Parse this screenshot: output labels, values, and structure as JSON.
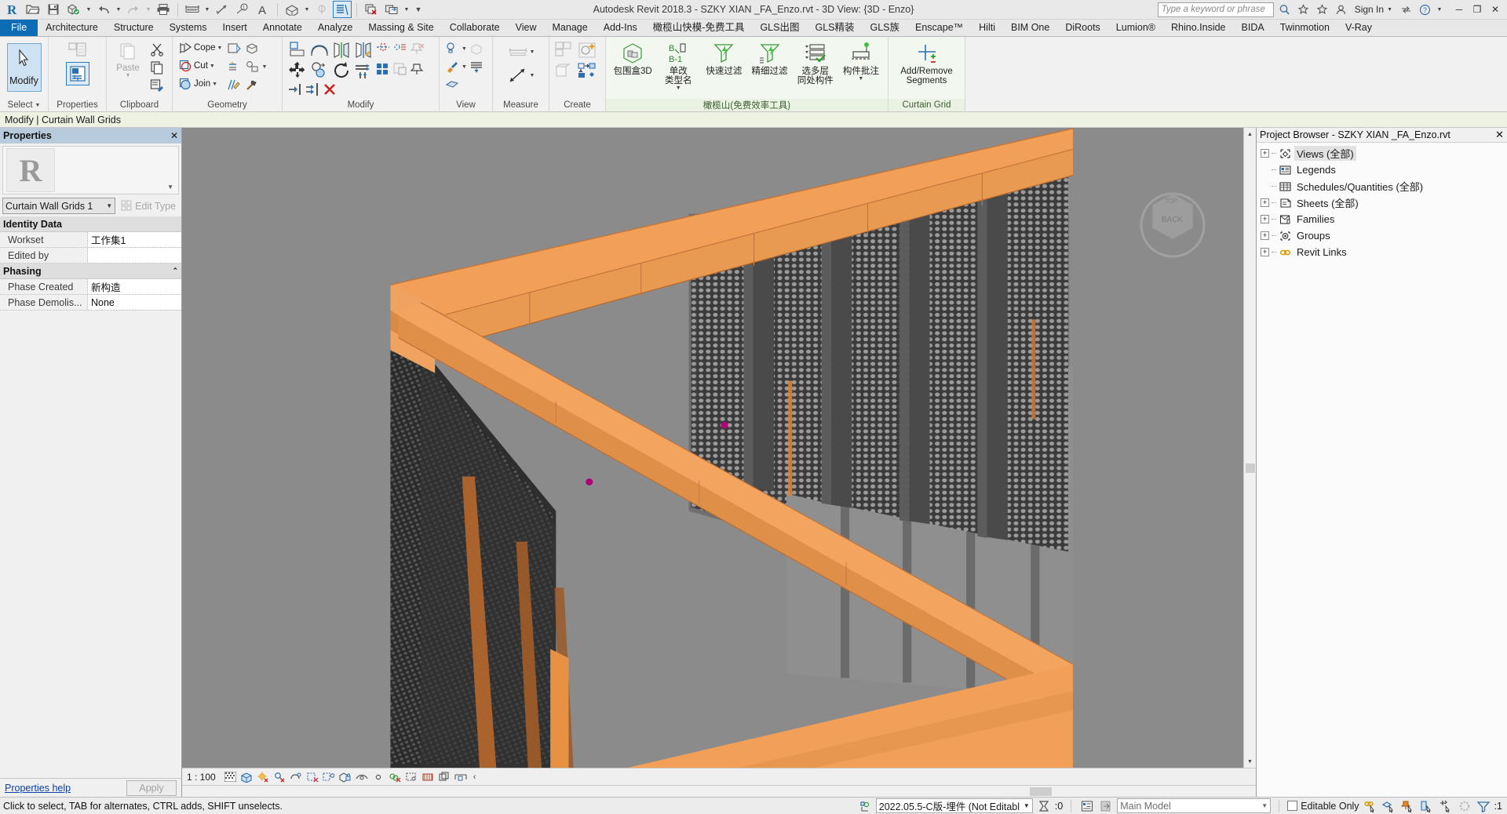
{
  "app": {
    "title": "Autodesk Revit 2018.3 -     SZKY XIAN _FA_Enzo.rvt - 3D View: {3D - Enzo}",
    "signin_label": "Sign In"
  },
  "search": {
    "placeholder": "Type a keyword or phrase",
    "value": ""
  },
  "window_buttons": {
    "minimize": "─",
    "restore": "❐",
    "close": "✕"
  },
  "quick_access": [
    {
      "name": "revit-logo-icon",
      "glyph": "R"
    },
    {
      "name": "open-icon",
      "glyph": "open"
    },
    {
      "name": "save-icon",
      "glyph": "save"
    },
    {
      "name": "sync-with-central-icon",
      "glyph": "sync"
    },
    {
      "name": "undo-icon",
      "glyph": "undo"
    },
    {
      "name": "redo-icon",
      "glyph": "redo"
    },
    {
      "name": "print-icon",
      "glyph": "print"
    },
    {
      "name": "measure-icon",
      "glyph": "measure"
    },
    {
      "name": "aligned-dimension-icon",
      "glyph": "aligned-dim"
    },
    {
      "name": "tag-icon",
      "glyph": "tag"
    },
    {
      "name": "text-icon",
      "glyph": "A"
    },
    {
      "name": "default-3d-view-icon",
      "glyph": "house3d"
    },
    {
      "name": "section-icon",
      "glyph": "section"
    },
    {
      "name": "thin-lines-icon",
      "glyph": "thinlines"
    },
    {
      "name": "close-hidden-windows-icon",
      "glyph": "closehidden"
    },
    {
      "name": "switch-windows-icon",
      "glyph": "switchwin"
    },
    {
      "name": "customize-qat-icon",
      "glyph": "chevron"
    }
  ],
  "tabs": [
    {
      "label": "File",
      "kind": "file"
    },
    {
      "label": "Architecture"
    },
    {
      "label": "Structure"
    },
    {
      "label": "Systems"
    },
    {
      "label": "Insert"
    },
    {
      "label": "Annotate"
    },
    {
      "label": "Analyze"
    },
    {
      "label": "Massing & Site"
    },
    {
      "label": "Collaborate"
    },
    {
      "label": "View"
    },
    {
      "label": "Manage"
    },
    {
      "label": "Add-Ins"
    },
    {
      "label": "橄榄山快模-免费工具"
    },
    {
      "label": "GLS出图"
    },
    {
      "label": "GLS精装"
    },
    {
      "label": "GLS族"
    },
    {
      "label": "Enscape™"
    },
    {
      "label": "Hilti"
    },
    {
      "label": "BIM One"
    },
    {
      "label": "DiRoots"
    },
    {
      "label": "Lumion®"
    },
    {
      "label": "Rhino.Inside"
    },
    {
      "label": "BIDA"
    },
    {
      "label": "Twinmotion"
    },
    {
      "label": "V-Ray"
    }
  ],
  "ribbon": {
    "panels": [
      {
        "name": "select",
        "title": "Select",
        "title_caret": true,
        "buttons": [
          {
            "label": "Modify",
            "name": "modify-button"
          }
        ]
      },
      {
        "name": "properties",
        "title": "Properties",
        "buttons": [
          {
            "label": "",
            "name": "properties-button"
          }
        ]
      },
      {
        "name": "clipboard",
        "title": "Clipboard",
        "buttons": [
          {
            "label": "Paste",
            "name": "paste-button"
          }
        ]
      },
      {
        "name": "geometry",
        "title": "Geometry",
        "buttons": [
          {
            "label": "Cope",
            "name": "cope-button"
          },
          {
            "label": "Cut",
            "name": "cut-button"
          },
          {
            "label": "Join",
            "name": "join-button"
          }
        ]
      },
      {
        "name": "modify",
        "title": "Modify",
        "buttons": []
      },
      {
        "name": "view",
        "title": "View",
        "buttons": []
      },
      {
        "name": "measure",
        "title": "Measure",
        "buttons": []
      },
      {
        "name": "create",
        "title": "Create",
        "buttons": []
      },
      {
        "name": "ganlanshan",
        "title": "橄榄山(免费效率工具)",
        "green": true,
        "buttons": [
          {
            "label": "包围盒3D",
            "name": "bounding-box-3d-button"
          },
          {
            "label": "单改\n类型名",
            "name": "rename-type-button"
          },
          {
            "label": "快速过滤",
            "name": "quick-filter-button"
          },
          {
            "label": "精细过滤",
            "name": "fine-filter-button"
          },
          {
            "label": "选多层\n同处构件",
            "name": "select-overlapping-button"
          },
          {
            "label": "构件批注",
            "name": "batch-annotate-button"
          }
        ]
      },
      {
        "name": "curtain-grid",
        "title": "Curtain Grid",
        "green": true,
        "buttons": [
          {
            "label": "Add/Remove\nSegments",
            "name": "add-remove-segments-button"
          }
        ]
      }
    ]
  },
  "options_bar": {
    "label": "Modify | Curtain Wall Grids"
  },
  "properties": {
    "header": "Properties",
    "close_glyph": "✕",
    "type_selector": "Curtain Wall Grids 1",
    "edit_type_label": "Edit Type",
    "groups": [
      {
        "name": "Identity Data",
        "rows": [
          {
            "name": "Workset",
            "value": "工作集1"
          },
          {
            "name": "Edited by",
            "value": ""
          }
        ]
      },
      {
        "name": "Phasing",
        "collapse_glyph": "⌃",
        "rows": [
          {
            "name": "Phase Created",
            "value": "新构造"
          },
          {
            "name": "Phase Demolis...",
            "value": "None"
          }
        ]
      }
    ],
    "help_link": "Properties help",
    "apply_label": "Apply"
  },
  "view_controls": {
    "scale": "1 : 100",
    "icons": [
      "detail-level-icon",
      "visual-style-icon",
      "sun-path-icon",
      "shadows-icon",
      "rendering-dialog-icon",
      "crop-view-icon",
      "show-crop-region-icon",
      "lock-3d-view-icon",
      "temporary-hide-isolate-icon",
      "reveal-hidden-elements-icon",
      "temporary-view-properties-icon",
      "analytical-model-icon",
      "constraints-icon",
      "worksharing-display-icon",
      "expand-bar-icon"
    ],
    "expand_glyph": "‹"
  },
  "browser": {
    "title": "Project Browser - SZKY XIAN _FA_Enzo.rvt",
    "close_glyph": "✕",
    "nodes": [
      {
        "label": "Views (全部)",
        "icon": "views-icon",
        "expandable": true,
        "selected": true
      },
      {
        "label": "Legends",
        "icon": "legends-icon",
        "expandable": false
      },
      {
        "label": "Schedules/Quantities (全部)",
        "icon": "schedules-icon",
        "expandable": false
      },
      {
        "label": "Sheets (全部)",
        "icon": "sheets-icon",
        "expandable": true
      },
      {
        "label": "Families",
        "icon": "families-icon",
        "expandable": true
      },
      {
        "label": "Groups",
        "icon": "groups-icon",
        "expandable": true
      },
      {
        "label": "Revit Links",
        "icon": "revit-links-icon",
        "expandable": true
      }
    ]
  },
  "status": {
    "message": "Click to select, TAB for alternates, CTRL adds, SHIFT unselects.",
    "workset": "2022.05.5-C版-埋件 (Not Editabl",
    "editable_count": ":0",
    "design_option": "Main Model",
    "editable_only_label": "Editable Only",
    "filter_count": ":1",
    "right_icons": [
      "select-links-icon",
      "select-underlay-icon",
      "select-pinned-icon",
      "select-by-face-icon",
      "drag-elements-icon",
      "worksharing-icon",
      "filter-icon"
    ]
  },
  "colors": {
    "accent": "#0c6cb5",
    "ribbon_bg": "#f1f1f1",
    "panel_green": "#f2f7ef",
    "properties_header": "#b8cbdd",
    "viewport_bg": "#8b8b8b",
    "model_orange": "#f2a058",
    "model_orange_dark": "#d2854a",
    "model_gray": "#909090",
    "model_dark": "#3c3c3c",
    "selection_magenta": "#b0007a"
  }
}
